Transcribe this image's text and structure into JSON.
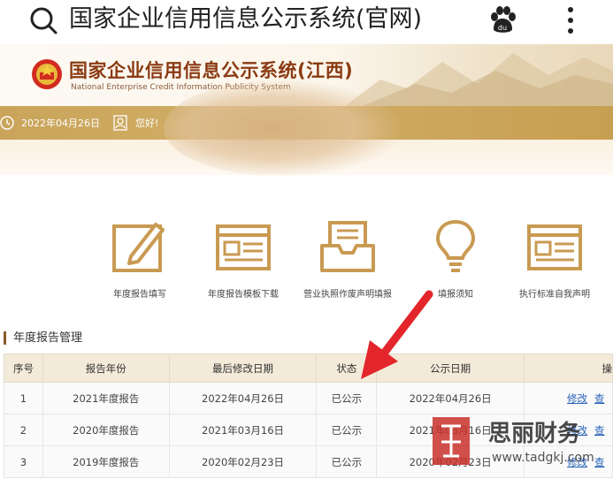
{
  "search": {
    "query": "国家企业信用信息公示系统(官网)"
  },
  "header": {
    "title": "国家企业信用信息公示系统(江西)",
    "subtitle": "National Enterprise Credit Information Publicity System"
  },
  "info_bar": {
    "date": "2022年04月26日",
    "greeting": "您好!"
  },
  "tools": [
    {
      "label": "年度报告填写",
      "icon": "edit-form-icon"
    },
    {
      "label": "年度报告模板下载",
      "icon": "template-download-icon"
    },
    {
      "label": "营业执照作废声明填报",
      "icon": "inbox-declaration-icon"
    },
    {
      "label": "填报须知",
      "icon": "lightbulb-icon"
    },
    {
      "label": "执行标准自我声明",
      "icon": "standard-declaration-icon"
    }
  ],
  "section": {
    "title": "年度报告管理"
  },
  "table": {
    "headers": [
      "序号",
      "报告年份",
      "最后修改日期",
      "状态",
      "公示日期",
      "操"
    ],
    "rows": [
      {
        "no": "1",
        "year": "2021年度报告",
        "modified": "2022年04月26日",
        "status": "已公示",
        "published": "2022年04月26日",
        "edit": "修改",
        "view": "查"
      },
      {
        "no": "2",
        "year": "2020年度报告",
        "modified": "2021年03月16日",
        "status": "已公示",
        "published": "2021年03月16日",
        "edit": "修改",
        "view": "查"
      },
      {
        "no": "3",
        "year": "2019年度报告",
        "modified": "2020年02月23日",
        "status": "已公示",
        "published": "2020年02月23日",
        "edit": "修改",
        "view": "查"
      }
    ]
  },
  "watermark": {
    "brand": "思丽财务",
    "url": "www.tadgkj.com"
  },
  "colors": {
    "gold": "#c9a45a",
    "title_brown": "#8a3a12",
    "arrow_red": "#e3262b",
    "link_blue": "#2a64b8",
    "header_bg": "#f3ead9"
  }
}
